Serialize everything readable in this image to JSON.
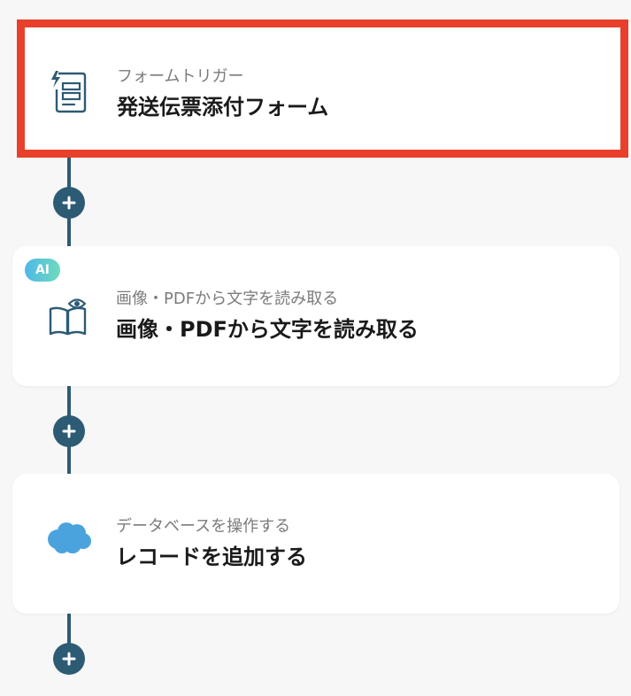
{
  "steps": [
    {
      "subtitle": "フォームトリガー",
      "title": "発送伝票添付フォーム",
      "icon": "form-icon",
      "selected": true
    },
    {
      "subtitle": "画像・PDFから文字を読み取る",
      "title": "画像・PDFから文字を読み取る",
      "icon": "book-eye-icon",
      "badge": "AI"
    },
    {
      "subtitle": "データベースを操作する",
      "title": "レコードを追加する",
      "icon": "salesforce-cloud-icon"
    }
  ],
  "colors": {
    "connector": "#2d5b74",
    "selection_border": "#e8402a",
    "salesforce": "#4ba3dd"
  }
}
